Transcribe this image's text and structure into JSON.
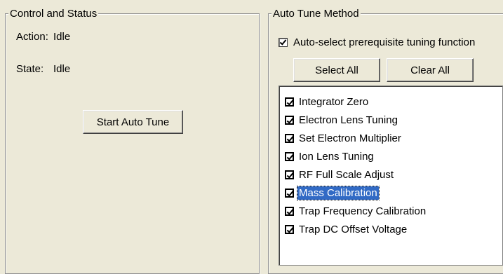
{
  "control_status": {
    "title": "Control and Status",
    "action_label": "Action:",
    "action_value": "Idle",
    "state_label": "State:",
    "state_value": "Idle",
    "start_button": "Start Auto Tune"
  },
  "auto_tune": {
    "title": "Auto Tune Method",
    "auto_select_label": "Auto-select prerequisite tuning function",
    "auto_select_checked": true,
    "select_all": "Select All",
    "clear_all": "Clear All",
    "items": [
      {
        "label": "Integrator Zero",
        "checked": true,
        "selected": false
      },
      {
        "label": "Electron Lens Tuning",
        "checked": true,
        "selected": false
      },
      {
        "label": "Set Electron Multiplier",
        "checked": true,
        "selected": false
      },
      {
        "label": "Ion Lens Tuning",
        "checked": true,
        "selected": false
      },
      {
        "label": "RF Full Scale Adjust",
        "checked": true,
        "selected": false
      },
      {
        "label": "Mass Calibration",
        "checked": true,
        "selected": true
      },
      {
        "label": "Trap Frequency Calibration",
        "checked": true,
        "selected": false
      },
      {
        "label": "Trap DC Offset Voltage",
        "checked": true,
        "selected": false
      }
    ]
  }
}
